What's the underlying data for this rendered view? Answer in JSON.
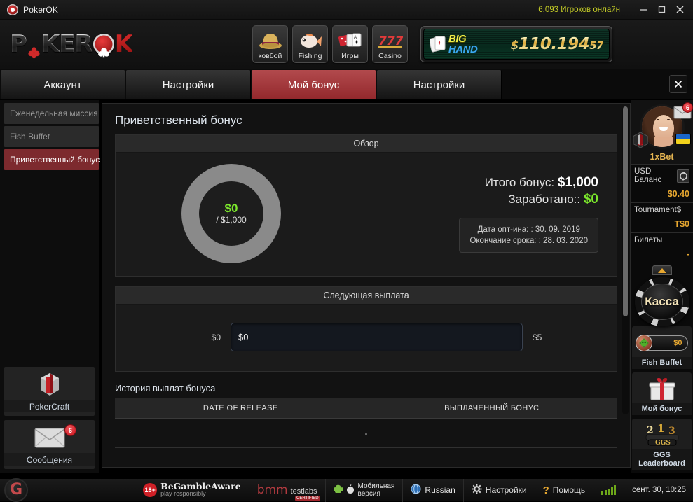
{
  "titlebar": {
    "app_title": "PokerOK",
    "players_online": "6,093 Игроков онлайн",
    "minimize": "—",
    "maximize": "□",
    "close": "✕"
  },
  "header": {
    "brand": {
      "p": "P",
      "oker": "KER",
      "k": "K"
    },
    "tiles": [
      {
        "label": "ковбой",
        "icon": "cowboy-hat-icon"
      },
      {
        "label": "Fishing",
        "icon": "fish-icon"
      },
      {
        "label": "Игры",
        "icon": "dice-cards-icon"
      },
      {
        "label": "Casino",
        "icon": "slot-777-icon"
      }
    ],
    "jackpot": {
      "big": "BIG",
      "hand": "HAND",
      "currency": "$",
      "amount": "110.194",
      "cents": "57"
    }
  },
  "tabs": [
    {
      "label": "Аккаунт",
      "active": false
    },
    {
      "label": "Настройки",
      "active": false
    },
    {
      "label": "Мой бонус",
      "active": true
    },
    {
      "label": "Настройки",
      "active": false
    }
  ],
  "sidebar_left": {
    "menu": [
      {
        "label": "Еженедельная миссия",
        "active": false
      },
      {
        "label": "Fish Buffet",
        "active": false
      },
      {
        "label": "Приветственный бонус",
        "active": true
      }
    ],
    "buttons": [
      {
        "label": "PokerCraft",
        "icon": "pokercraft-cube-icon",
        "badge": ""
      },
      {
        "label": "Сообщения",
        "icon": "envelope-icon",
        "badge": "6"
      }
    ]
  },
  "main": {
    "title": "Приветственный бонус",
    "overview": {
      "header": "Обзор",
      "donut_value": "$0",
      "donut_max": "/ $1,000",
      "donut_percent": 0,
      "total_bonus_label": "Итого бонус:",
      "total_bonus_value": "$1,000",
      "earned_label": "Заработано::",
      "earned_value": "$0",
      "optin_date": "Дата опт-ина: : 30. 09. 2019",
      "expiry_date": "Окончание срока: : 28. 03. 2020"
    },
    "next_payout": {
      "header": "Следующая выплата",
      "min": "$0",
      "current": "$0",
      "max": "$5",
      "progress_percent": 0
    },
    "history": {
      "title": "История выплат бонуса",
      "columns": [
        "DATE OF RELEASE",
        "ВЫПЛАЧЕННЫЙ БОНУС"
      ],
      "rows": [
        [
          "-"
        ]
      ]
    }
  },
  "sidebar_right": {
    "username": "1xBet",
    "mail_badge": "6",
    "balances": [
      {
        "label": "USD Баланс",
        "value": "$0.40"
      },
      {
        "label": "Tournament$",
        "value": "T$0"
      },
      {
        "label": "Билеты",
        "value": "-"
      }
    ],
    "cashier_label": "Касса",
    "buttons": [
      {
        "label": "Fish Buffet",
        "icon": "fish-buffet-icon",
        "amount": "$0"
      },
      {
        "label": "Мой бонус",
        "icon": "gift-box-icon",
        "amount": ""
      },
      {
        "label": "GGS Leaderboard",
        "icon": "podium-icon",
        "amount": ""
      }
    ]
  },
  "statusbar": {
    "age_rating": "18+",
    "gamble_aware_1": "BeGambleAware",
    "gamble_aware_2": "play responsibly",
    "bmm_1": "bmm",
    "bmm_2": "testlabs",
    "bmm_3": "CERTIFIED",
    "mobile_1": "Мобильная",
    "mobile_2": "версия",
    "language": "Russian",
    "settings": "Настройки",
    "help": "Помощь",
    "clock": "сент. 30, 10:25"
  },
  "colors": {
    "accent_red": "#93282c",
    "gold": "#e8a830",
    "green": "#7ce82c",
    "players_green": "#c4cc26"
  }
}
